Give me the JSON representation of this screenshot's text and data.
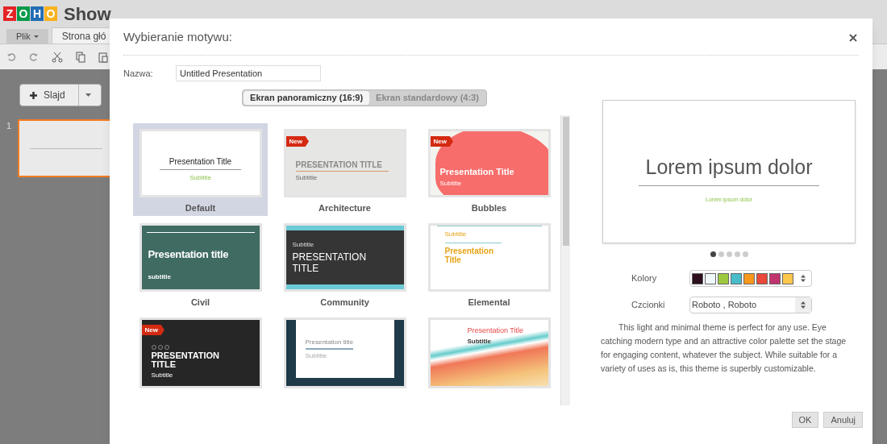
{
  "app": {
    "logo_letters": [
      {
        "text": "Z",
        "color": "#e42527"
      },
      {
        "text": "O",
        "color": "#089949"
      },
      {
        "text": "H",
        "color": "#226db4"
      },
      {
        "text": "O",
        "color": "#f9b21d"
      }
    ],
    "product": "Show",
    "tabs": [
      {
        "label": "Plik",
        "selected": false
      },
      {
        "label": "Strona głó",
        "selected": true
      }
    ],
    "add_slide_button": "Slajd",
    "slide_number": "1"
  },
  "dialog": {
    "title": "Wybieranie motywu:",
    "name_label": "Nazwa:",
    "name_value": "Untitled Presentation",
    "aspect_tabs": [
      {
        "label": "Ekran panoramiczny (16:9)",
        "selected": true
      },
      {
        "label": "Ekran standardowy (4:3)",
        "selected": false
      }
    ],
    "themes": [
      {
        "kind": "default",
        "name": "Default",
        "selected": true,
        "title": "Presentation Title",
        "subtitle": "Subtitle"
      },
      {
        "kind": "architecture",
        "name": "Architecture",
        "selected": false,
        "badge": "New",
        "title": "PRESENTATION TITLE",
        "subtitle": "Subtitle"
      },
      {
        "kind": "bubbles",
        "name": "Bubbles",
        "selected": false,
        "badge": "New",
        "title": "Presentation Title",
        "subtitle": "Subtitle"
      },
      {
        "kind": "civil",
        "name": "Civil",
        "selected": false,
        "title": "Presentation title",
        "subtitle": "subtitle"
      },
      {
        "kind": "community",
        "name": "Community",
        "selected": false,
        "title": "PRESENTATION TITLE",
        "subtitle": "Subtitle"
      },
      {
        "kind": "elemental",
        "name": "Elemental",
        "selected": false,
        "title": "Presentation Title",
        "subtitle": "Subtitle"
      },
      {
        "kind": "dark",
        "selected": false,
        "badge": "New",
        "title": "PRESENTATION TITLE",
        "subtitle": "Subtitle"
      },
      {
        "kind": "slate",
        "selected": false,
        "title": "Presentation title",
        "subtitle": "Subtitle"
      },
      {
        "kind": "waves",
        "selected": false,
        "title": "Presentation Title",
        "subtitle": "Subtitle"
      }
    ],
    "preview": {
      "title": "Lorem ipsum dolor",
      "subtitle": "Lorem ipsum dolor",
      "pages": [
        {
          "selected": true
        },
        {
          "selected": false
        },
        {
          "selected": false
        },
        {
          "selected": false
        },
        {
          "selected": false
        }
      ]
    },
    "colors_label": "Kolory",
    "colors": [
      {
        "color": "#2d0f1e"
      },
      {
        "color": "#f0f8fa"
      },
      {
        "color": "#9dc93f"
      },
      {
        "color": "#49bcc9"
      },
      {
        "color": "#f7981c"
      },
      {
        "color": "#e9483a"
      },
      {
        "color": "#c0336e"
      },
      {
        "color": "#fdc84b"
      }
    ],
    "fonts_label": "Czcionki",
    "fonts_value": "Roboto , Roboto",
    "description": "This light and minimal theme is perfect for any use. Eye catching modern type and an attractive color palette set the stage for engaging content, whatever the subject. While suitable for a variety of uses as is, this theme is superbly customizable.",
    "buttons": [
      "OK",
      "Anuluj"
    ]
  }
}
